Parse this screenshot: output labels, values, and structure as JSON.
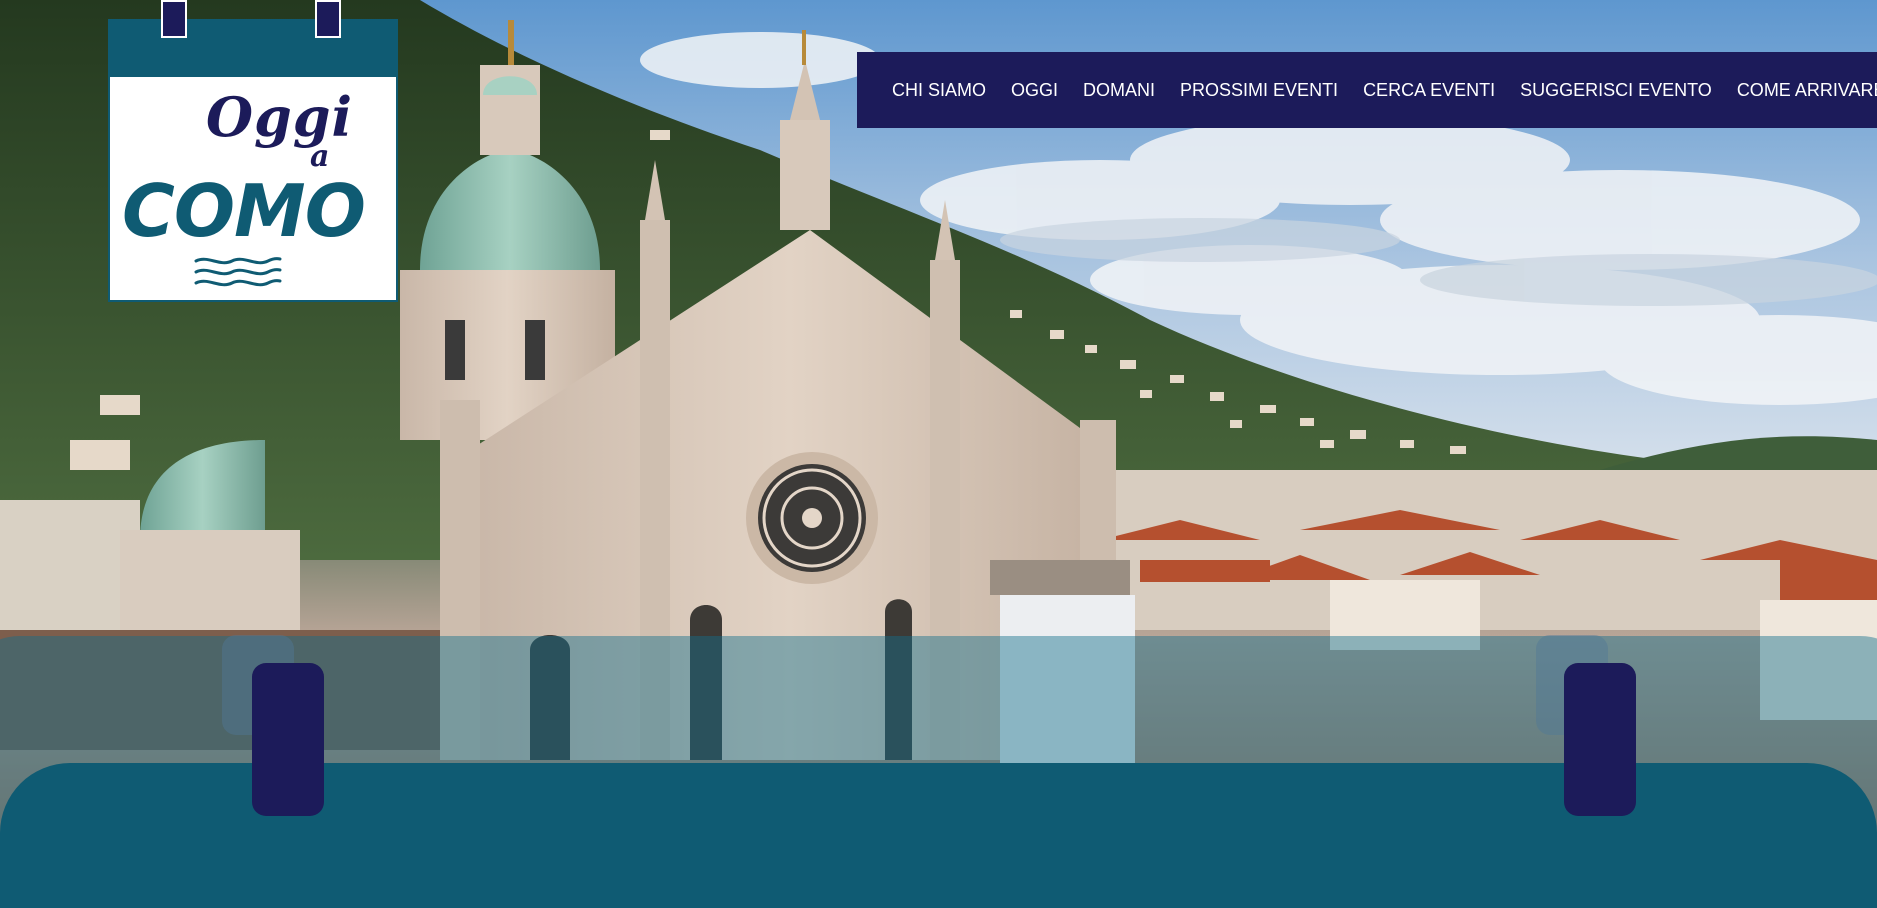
{
  "logo": {
    "line1": "Oggi",
    "line2": "a",
    "line3": "COMO"
  },
  "nav": {
    "items": [
      {
        "label": "CHI SIAMO"
      },
      {
        "label": "OGGI"
      },
      {
        "label": "DOMANI"
      },
      {
        "label": "PROSSIMI EVENTI"
      },
      {
        "label": "CERCA EVENTI"
      },
      {
        "label": "SUGGERISCI EVENTO"
      },
      {
        "label": "COME ARRIVARE"
      }
    ]
  },
  "colors": {
    "navy": "#1c1b5a",
    "teal": "#0f5b73"
  }
}
